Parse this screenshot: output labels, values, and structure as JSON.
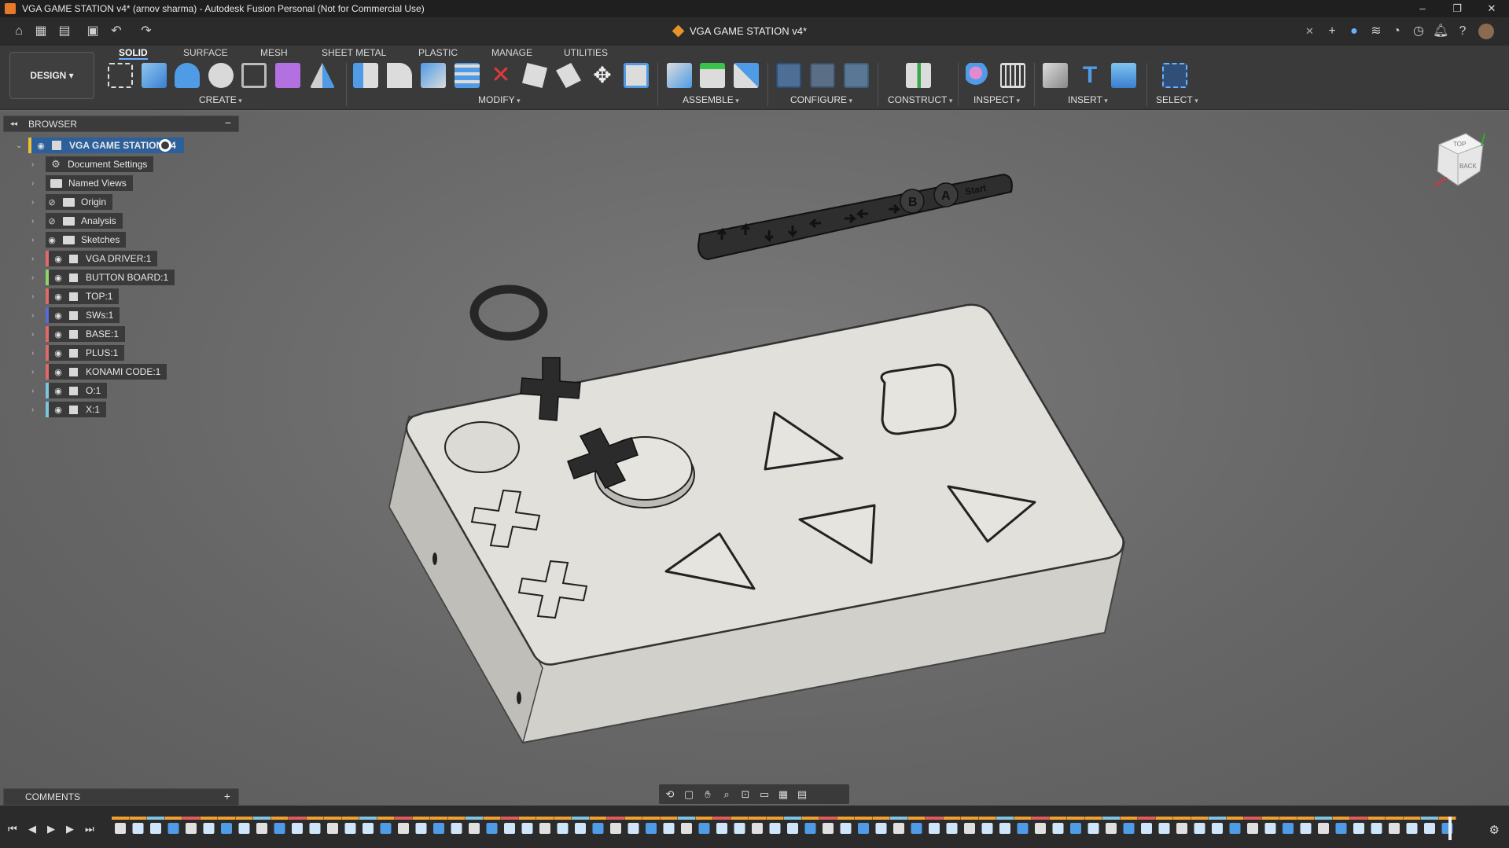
{
  "window": {
    "title": "VGA GAME STATION v4* (arnov sharma) - Autodesk Fusion Personal (Not for Commercial Use)",
    "controls": [
      "–",
      "❐",
      "✕"
    ]
  },
  "tabbar": {
    "document_tab": "VGA GAME STATION v4*",
    "close": "✕"
  },
  "ribbon": {
    "workspace": "DESIGN",
    "tabs": [
      "SOLID",
      "SURFACE",
      "MESH",
      "SHEET METAL",
      "PLASTIC",
      "MANAGE",
      "UTILITIES"
    ],
    "active_tab": "SOLID",
    "groups": [
      "CREATE",
      "MODIFY",
      "ASSEMBLE",
      "CONFIGURE",
      "CONSTRUCT",
      "INSPECT",
      "INSERT",
      "SELECT"
    ]
  },
  "browser": {
    "header": "BROWSER",
    "root": "VGA GAME STATION v4",
    "items": [
      {
        "label": "Document Settings",
        "kind": "gear",
        "visibility": "none"
      },
      {
        "label": "Named Views",
        "kind": "folder",
        "visibility": "none"
      },
      {
        "label": "Origin",
        "kind": "folder",
        "visibility": "hidden"
      },
      {
        "label": "Analysis",
        "kind": "folder",
        "visibility": "hidden"
      },
      {
        "label": "Sketches",
        "kind": "folder",
        "visibility": "visible"
      },
      {
        "label": "VGA DRIVER:1",
        "kind": "component",
        "color": "#e06a6a"
      },
      {
        "label": "BUTTON BOARD:1",
        "kind": "body",
        "color": "#8fd46a"
      },
      {
        "label": "TOP:1",
        "kind": "body",
        "color": "#e06a6a"
      },
      {
        "label": "SWs:1",
        "kind": "body",
        "color": "#5a6ad8"
      },
      {
        "label": "BASE:1",
        "kind": "body",
        "color": "#e06a6a"
      },
      {
        "label": "PLUS:1",
        "kind": "body",
        "color": "#e06a6a"
      },
      {
        "label": "KONAMI CODE:1",
        "kind": "body",
        "color": "#e06a6a"
      },
      {
        "label": "O:1",
        "kind": "body",
        "color": "#7fc3e0"
      },
      {
        "label": "X:1",
        "kind": "body",
        "color": "#7fc3e0"
      }
    ]
  },
  "comments": {
    "label": "COMMENTS",
    "add": "+"
  },
  "viewcube": {
    "face_top": "TOP",
    "face_back": "BACK"
  },
  "model": {
    "strip_text": "Start",
    "strip_b": "B",
    "strip_a": "A"
  },
  "colors": {
    "accent": "#6ab0ff",
    "titlebar": "#1f1f1f",
    "ribbon": "#3a3a3a",
    "canvas": "#6b6b6b",
    "root_highlight": "#2d5f9a"
  }
}
